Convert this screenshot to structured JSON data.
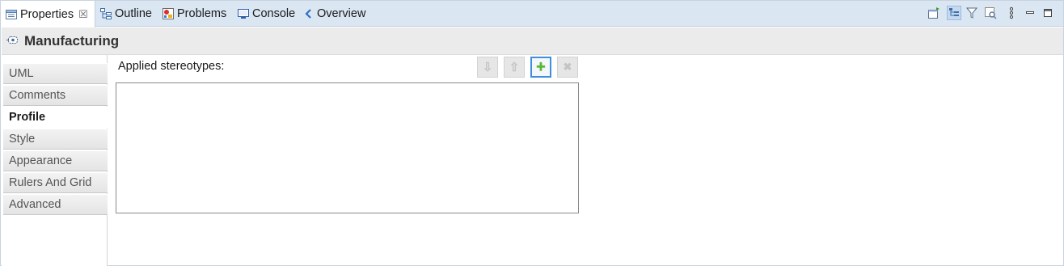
{
  "tabs": [
    {
      "label": "Properties",
      "icon": "properties-icon",
      "active": true,
      "close": "☒"
    },
    {
      "label": "Outline",
      "icon": "outline-icon"
    },
    {
      "label": "Problems",
      "icon": "problems-icon"
    },
    {
      "label": "Console",
      "icon": "console-icon"
    },
    {
      "label": "Overview",
      "icon": "overview-icon"
    }
  ],
  "toolbar": {
    "icons": [
      "new-view-icon",
      "categories-icon",
      "filter-icon",
      "advanced-icon",
      "view-menu-icon",
      "minimize-icon",
      "maximize-icon"
    ]
  },
  "title": {
    "icon": "element-icon",
    "text": "Manufacturing"
  },
  "nav": {
    "items": [
      {
        "label": "UML"
      },
      {
        "label": "Comments"
      },
      {
        "label": "Profile",
        "active": true
      },
      {
        "label": "Style"
      },
      {
        "label": "Appearance"
      },
      {
        "label": "Rulers And Grid"
      },
      {
        "label": "Advanced"
      }
    ]
  },
  "content": {
    "label": "Applied stereotypes:",
    "buttons": [
      {
        "name": "move-down-button",
        "icon": "arrow-down-icon",
        "glyph": "⇩",
        "enabled": false
      },
      {
        "name": "move-up-button",
        "icon": "arrow-up-icon",
        "glyph": "⇧",
        "enabled": false
      },
      {
        "name": "add-stereotype-button",
        "icon": "plus-icon",
        "glyph": "+",
        "enabled": true
      },
      {
        "name": "remove-stereotype-button",
        "icon": "delete-icon",
        "glyph": "✖",
        "enabled": false
      }
    ],
    "stereotypes": []
  },
  "colors": {
    "accent": "#3f8ddb",
    "tabbar": "#dbe6f3",
    "add_green": "#58b82f"
  }
}
